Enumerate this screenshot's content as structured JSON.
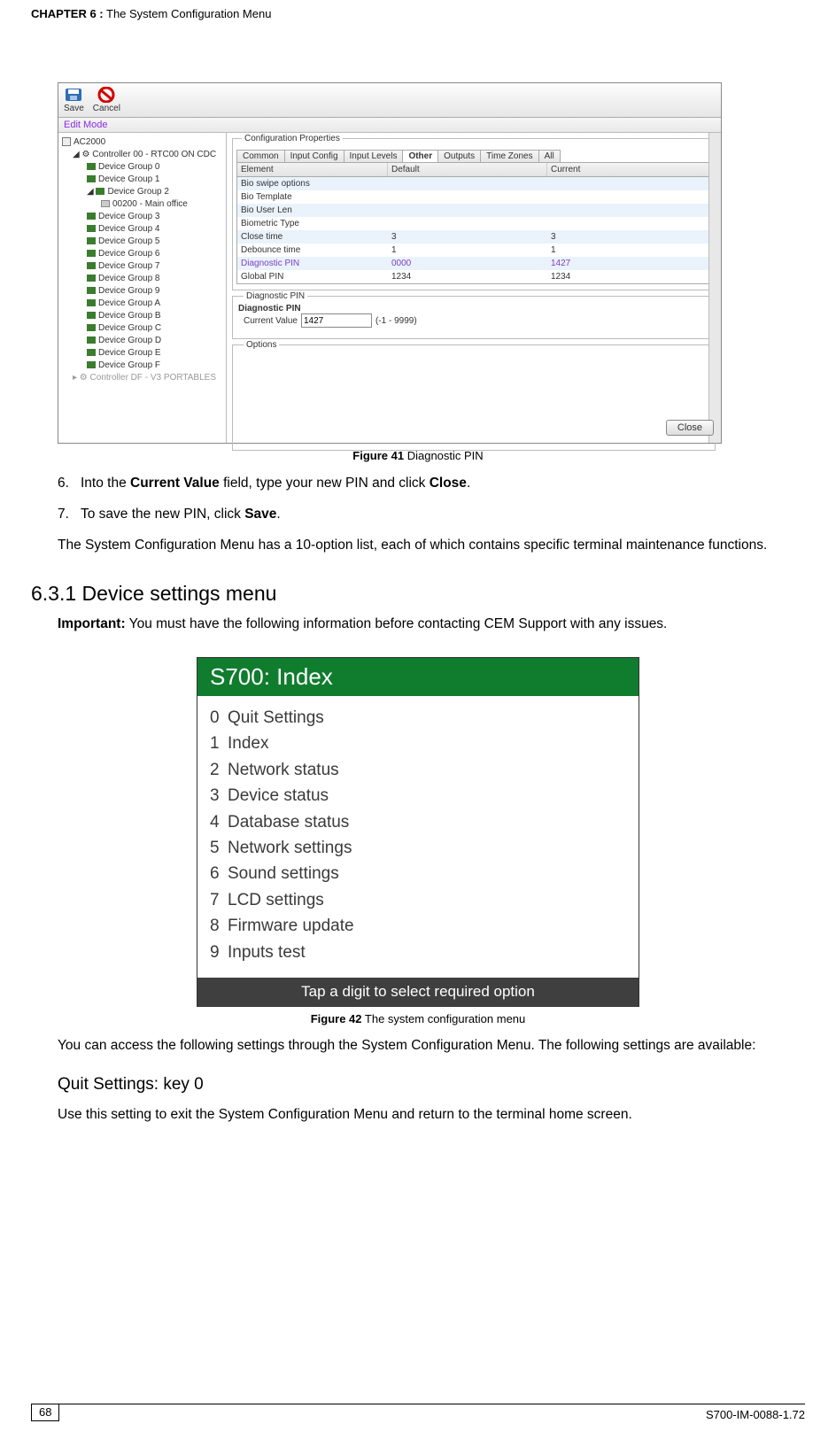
{
  "header": {
    "chapter_label": "CHAPTER  6 :",
    "chapter_title": " The System Configuration Menu"
  },
  "ss1": {
    "toolbar": {
      "save": "Save",
      "cancel": "Cancel"
    },
    "edit_mode": "Edit Mode",
    "tree": {
      "root": "AC2000",
      "controller": "Controller 00 - RTC00 ON CDC",
      "groups": [
        "Device Group 0",
        "Device Group 1",
        "Device Group 2",
        "Device Group 3",
        "Device Group 4",
        "Device Group 5",
        "Device Group 6",
        "Device Group 7",
        "Device Group 8",
        "Device Group 9",
        "Device Group A",
        "Device Group B",
        "Device Group C",
        "Device Group D",
        "Device Group E",
        "Device Group F"
      ],
      "leaf": "00200 - Main office",
      "controller_df": "Controller DF - V3 PORTABLES"
    },
    "right": {
      "panel_title": "Configuration Properties",
      "tabs": [
        "Common",
        "Input Config",
        "Input Levels",
        "Other",
        "Outputs",
        "Time Zones",
        "All"
      ],
      "active_tab_index": 3,
      "columns": [
        "Element",
        "Default",
        "Current"
      ],
      "rows": [
        {
          "el": "Bio swipe options",
          "def": "",
          "cur": ""
        },
        {
          "el": "Bio Template",
          "def": "",
          "cur": ""
        },
        {
          "el": "Bio User Len",
          "def": "",
          "cur": ""
        },
        {
          "el": "Biometric Type",
          "def": "",
          "cur": ""
        },
        {
          "el": "Close time",
          "def": "3",
          "cur": "3"
        },
        {
          "el": "Debounce time",
          "def": "1",
          "cur": "1"
        },
        {
          "el": "Diagnostic PIN",
          "def": "0000",
          "cur": "1427"
        },
        {
          "el": "Global PIN",
          "def": "1234",
          "cur": "1234"
        }
      ],
      "diag_group_title": "Diagnostic PIN",
      "diag_group_sub": "Diagnostic PIN",
      "current_value_label": "Current Value",
      "current_value": "1427",
      "current_value_range": "(-1 - 9999)",
      "options_title": "Options",
      "close_btn": "Close"
    }
  },
  "caption1": {
    "label": "Figure 41",
    "text": " Diagnostic PIN"
  },
  "steps": {
    "s6_num": "6.",
    "s6_a": "Into the ",
    "s6_b": "Current Value",
    "s6_c": " field, type your new PIN and click ",
    "s6_d": "Close",
    "s6_e": ".",
    "s7_num": "7.",
    "s7_a": "To save the new PIN, click ",
    "s7_b": "Save",
    "s7_c": "."
  },
  "para1": "The System Configuration Menu has a 10-option list, each of which contains specific terminal maintenance functions.",
  "h2": "6.3.1  Device settings menu",
  "important_label": "Important:",
  "important_text": " You must have the following information before contacting CEM Support with any issues.",
  "ss2": {
    "title": "S700: Index",
    "items": [
      {
        "n": "0",
        "label": "Quit Settings"
      },
      {
        "n": "1",
        "label": "Index"
      },
      {
        "n": "2",
        "label": "Network status"
      },
      {
        "n": "3",
        "label": "Device status"
      },
      {
        "n": "4",
        "label": "Database status"
      },
      {
        "n": "5",
        "label": "Network settings"
      },
      {
        "n": "6",
        "label": "Sound settings"
      },
      {
        "n": "7",
        "label": "LCD settings"
      },
      {
        "n": "8",
        "label": "Firmware update"
      },
      {
        "n": "9",
        "label": "Inputs test"
      }
    ],
    "footer": "Tap a digit to select required option"
  },
  "caption2": {
    "label": "Figure 42",
    "text": " The system configuration menu"
  },
  "para2": "You can access the following settings through the System Configuration Menu. The following settings are available:",
  "h3": "Quit Settings: key 0",
  "para3": "Use this setting to exit the System Configuration Menu and return to the terminal home screen.",
  "footer": {
    "page": "68",
    "doc": "S700-IM-0088-1.72"
  }
}
